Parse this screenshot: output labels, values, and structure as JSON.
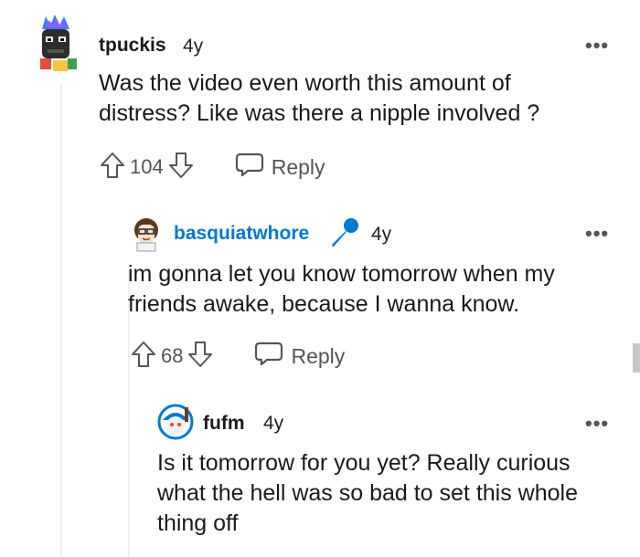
{
  "comments": [
    {
      "username": "tpuckis",
      "age": "4y",
      "body": "Was the video even worth this amount of distress? Like was there a nipple involved ?",
      "votes": "104",
      "reply_label": "Reply",
      "more_label": "•••"
    },
    {
      "username": "basquiatwhore",
      "age": "4y",
      "flair_icon": "microphone-icon",
      "body": "im gonna let you know tomorrow when my friends awake, because I wanna know.",
      "votes": "68",
      "reply_label": "Reply",
      "more_label": "•••"
    },
    {
      "username": "fufm",
      "age": "4y",
      "body": "Is it tomorrow for you yet? Really curious what the hell was so bad to set this whole thing off",
      "more_label": "•••"
    }
  ],
  "colors": {
    "username_blue": "#0079d3",
    "text": "#1a1a1b",
    "meta": "#555555",
    "thread_line": "#edeff1"
  }
}
